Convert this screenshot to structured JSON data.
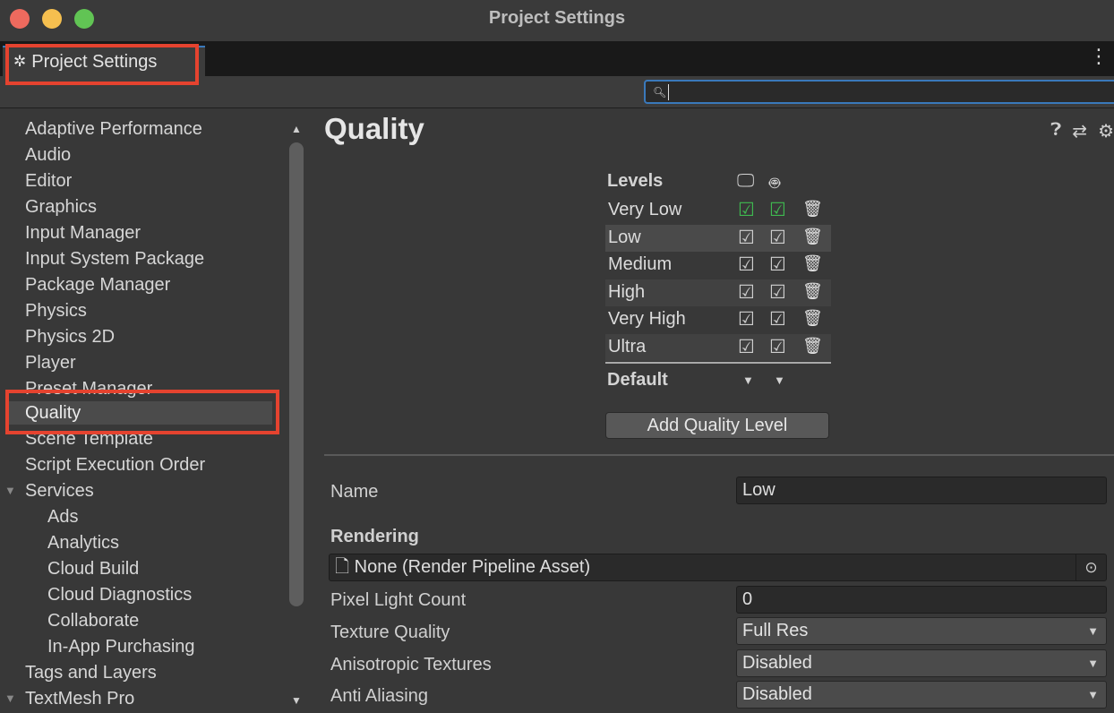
{
  "window": {
    "title": "Project Settings"
  },
  "tab": {
    "label": "Project Settings",
    "icon": "gear-icon"
  },
  "search": {
    "value": "",
    "placeholder": ""
  },
  "sidebar": {
    "items": [
      {
        "label": "Adaptive Performance",
        "level": 0
      },
      {
        "label": "Audio",
        "level": 0
      },
      {
        "label": "Editor",
        "level": 0
      },
      {
        "label": "Graphics",
        "level": 0
      },
      {
        "label": "Input Manager",
        "level": 0
      },
      {
        "label": "Input System Package",
        "level": 0
      },
      {
        "label": "Package Manager",
        "level": 0
      },
      {
        "label": "Physics",
        "level": 0
      },
      {
        "label": "Physics 2D",
        "level": 0
      },
      {
        "label": "Player",
        "level": 0
      },
      {
        "label": "Preset Manager",
        "level": 0
      },
      {
        "label": "Quality",
        "level": 0,
        "selected": true
      },
      {
        "label": "Scene Template",
        "level": 0
      },
      {
        "label": "Script Execution Order",
        "level": 0
      },
      {
        "label": "Services",
        "level": 0,
        "expanded": true
      },
      {
        "label": "Ads",
        "level": 1
      },
      {
        "label": "Analytics",
        "level": 1
      },
      {
        "label": "Cloud Build",
        "level": 1
      },
      {
        "label": "Cloud Diagnostics",
        "level": 1
      },
      {
        "label": "Collaborate",
        "level": 1
      },
      {
        "label": "In-App Purchasing",
        "level": 1
      },
      {
        "label": "Tags and Layers",
        "level": 0
      },
      {
        "label": "TextMesh Pro",
        "level": 0,
        "expanded": true
      }
    ]
  },
  "main": {
    "title": "Quality",
    "levels": {
      "header": "Levels",
      "platform_icons": [
        "desktop-icon",
        "android-icon"
      ],
      "rows": [
        {
          "name": "Very Low",
          "desktop": true,
          "android": true,
          "highlight": "green"
        },
        {
          "name": "Low",
          "desktop": true,
          "android": true,
          "selected": true
        },
        {
          "name": "Medium",
          "desktop": true,
          "android": true
        },
        {
          "name": "High",
          "desktop": true,
          "android": true
        },
        {
          "name": "Very High",
          "desktop": true,
          "android": true
        },
        {
          "name": "Ultra",
          "desktop": true,
          "android": true
        }
      ],
      "default_label": "Default",
      "add_button": "Add Quality Level"
    },
    "properties": {
      "name_label": "Name",
      "name_value": "Low",
      "rendering_header": "Rendering",
      "render_pipeline_asset": "None (Render Pipeline Asset)",
      "pixel_light_count_label": "Pixel Light Count",
      "pixel_light_count_value": "0",
      "texture_quality_label": "Texture Quality",
      "texture_quality_value": "Full Res",
      "anisotropic_label": "Anisotropic Textures",
      "anisotropic_value": "Disabled",
      "anti_aliasing_label": "Anti Aliasing",
      "anti_aliasing_value": "Disabled"
    }
  },
  "colors": {
    "highlight_box": "#e5432f",
    "focus_blue": "#3a79bb",
    "checked_green": "#3fb950"
  }
}
